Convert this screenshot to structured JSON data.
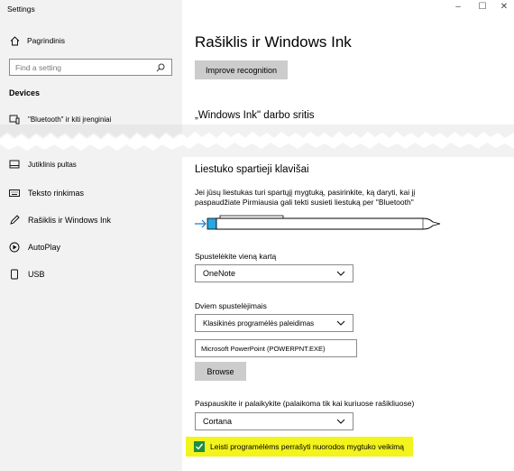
{
  "window": {
    "title": "Settings",
    "controls": {
      "minimize": "–",
      "maximize": "☐",
      "close": "✕"
    }
  },
  "sidebar": {
    "home_label": "Pagrindinis",
    "search_placeholder": "Find a setting",
    "section": "Devices",
    "items_top": [
      {
        "label": "\"Bluetooth\" ir kiti įrenginiai",
        "icon": "bluetooth-devices-icon"
      }
    ],
    "items_bottom": [
      {
        "label": "Jutiklinis pultas",
        "icon": "touchpad-icon"
      },
      {
        "label": "Teksto rinkimas",
        "icon": "keyboard-icon"
      },
      {
        "label": "Rašiklis ir Windows Ink",
        "icon": "pen-icon"
      },
      {
        "label": "AutoPlay",
        "icon": "autoplay-icon"
      },
      {
        "label": "USB",
        "icon": "usb-icon"
      }
    ]
  },
  "main": {
    "title": "Rašiklis ir Windows Ink",
    "improve_button": "Improve recognition",
    "ink_workspace_heading": "„Windows Ink\" darbo sritis",
    "shortcut_heading": "Liestuko spartieji klavišai",
    "shortcut_desc": "Jei jūsų liestukas turi spartųjį mygtuką, pasirinkite, ką daryti, kai jį paspaudžiate Pirmiausia gali tekti susieti liestuką per \"Bluetooth\"",
    "single_click": {
      "label": "Spustelėkite vieną kartą",
      "value": "OneNote"
    },
    "double_click": {
      "label": "Dviem spustelėjimais",
      "value": "Klasikinės programėlės paleidimas",
      "path": "Microsoft  PowerPoint (POWERPNT.EXE)",
      "browse": "Browse"
    },
    "press_hold": {
      "label": "Paspauskite ir palaikykite (palaikoma tik kai kuriuose rašikliuose)",
      "value": "Cortana"
    },
    "override_checkbox": {
      "label": "Leisti programėlėms perrašyti nuorodos mygtuko veikimą",
      "checked": true,
      "highlight_color": "#f3f31d"
    }
  }
}
